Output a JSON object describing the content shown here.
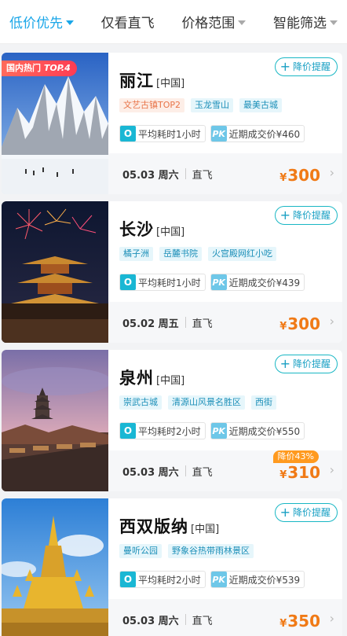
{
  "filters": [
    {
      "label": "低价优先"
    },
    {
      "label": "仅看直飞"
    },
    {
      "label": "价格范围"
    },
    {
      "label": "智能筛选"
    }
  ],
  "alert_label": "降价提醒",
  "cards": [
    {
      "badge_prefix": "国内热门",
      "badge_rank": "TOP.4",
      "city": "丽江",
      "country": "[中国]",
      "tags": [
        {
          "text": "文艺古镇TOP2",
          "hot": true
        },
        {
          "text": "玉龙雪山",
          "hot": false
        },
        {
          "text": "最美古城",
          "hot": false
        }
      ],
      "flight_icon": "O",
      "avg_time": "平均耗时1小时",
      "pk_icon": "PK",
      "recent_price": "近期成交价¥460",
      "date": "05.03 周六",
      "direct": "直飞",
      "yen": "¥",
      "price": "300"
    },
    {
      "city": "长沙",
      "country": "[中国]",
      "tags": [
        {
          "text": "橘子洲",
          "hot": false
        },
        {
          "text": "岳麓书院",
          "hot": false
        },
        {
          "text": "火宫殿网红小吃",
          "hot": false
        }
      ],
      "flight_icon": "O",
      "avg_time": "平均耗时1小时",
      "pk_icon": "PK",
      "recent_price": "近期成交价¥439",
      "date": "05.02 周五",
      "direct": "直飞",
      "yen": "¥",
      "price": "300"
    },
    {
      "city": "泉州",
      "country": "[中国]",
      "tags": [
        {
          "text": "崇武古城",
          "hot": false
        },
        {
          "text": "清源山风景名胜区",
          "hot": false
        },
        {
          "text": "西街",
          "hot": false
        }
      ],
      "flight_icon": "O",
      "avg_time": "平均耗时2小时",
      "pk_icon": "PK",
      "recent_price": "近期成交价¥550",
      "date": "05.03 周六",
      "direct": "直飞",
      "discount": "降价43%",
      "yen": "¥",
      "price": "310"
    },
    {
      "city": "西双版纳",
      "country": "[中国]",
      "tags": [
        {
          "text": "曼听公园",
          "hot": false
        },
        {
          "text": "野象谷热带雨林景区",
          "hot": false
        }
      ],
      "flight_icon": "O",
      "avg_time": "平均耗时2小时",
      "pk_icon": "PK",
      "recent_price": "近期成交价¥539",
      "date": "05.03 周六",
      "direct": "直飞",
      "yen": "¥",
      "price": "350"
    }
  ],
  "colors": {
    "accent": "#1aa6e8",
    "price": "#f07a16",
    "tag_bg": "#e6f6fb",
    "hot_tag_bg": "#fdeee7",
    "discount": "#ff9a1f"
  }
}
